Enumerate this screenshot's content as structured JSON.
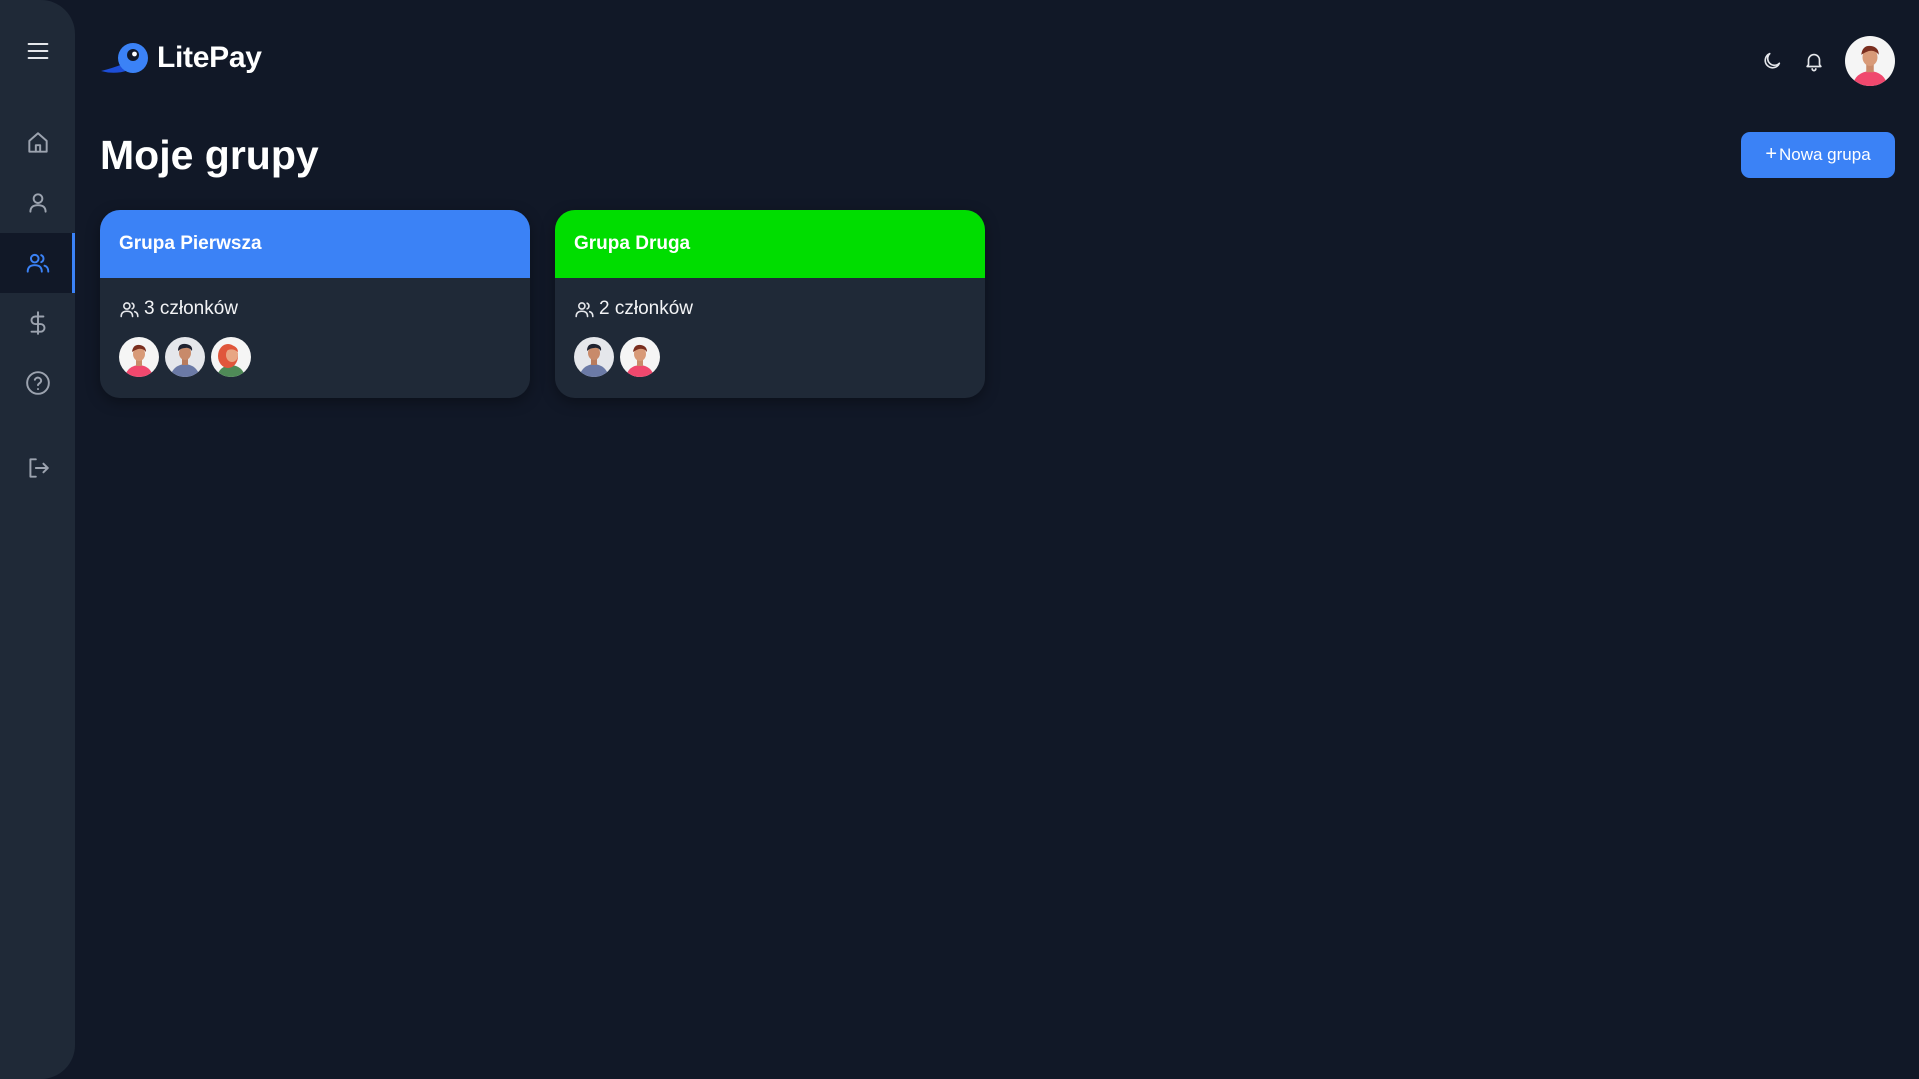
{
  "app": {
    "brand": "LitePay",
    "colors": {
      "background": "#111827",
      "sidebar": "#1f2937",
      "accent": "#3b82f6",
      "group_blue": "#3b82f6",
      "group_green": "#00dd00"
    }
  },
  "sidebar": {
    "menu_icon": "hamburger-menu-icon",
    "items": [
      {
        "name": "home",
        "icon": "home-icon",
        "active": false
      },
      {
        "name": "profile",
        "icon": "user-icon",
        "active": false
      },
      {
        "name": "groups",
        "icon": "users-icon",
        "active": true
      },
      {
        "name": "payments",
        "icon": "dollar-icon",
        "active": false
      },
      {
        "name": "help",
        "icon": "help-circle-icon",
        "active": false
      },
      {
        "name": "logout",
        "icon": "logout-icon",
        "active": false
      }
    ]
  },
  "header": {
    "theme_icon": "moon-icon",
    "notification_icon": "bell-icon",
    "user_avatar": "user-avatar"
  },
  "main": {
    "title": "Moje grupy",
    "new_button": {
      "icon": "+",
      "label": "Nowa grupa"
    },
    "groups": [
      {
        "name": "Grupa Pierwsza",
        "color": "#3b82f6",
        "members_label": "3 członków",
        "avatars": [
          "avatar-woman-pink",
          "avatar-man-dark",
          "avatar-woman-red-hair"
        ]
      },
      {
        "name": "Grupa Druga",
        "color": "#00dd00",
        "members_label": "2 członków",
        "avatars": [
          "avatar-man-dark",
          "avatar-woman-pink"
        ]
      }
    ]
  }
}
